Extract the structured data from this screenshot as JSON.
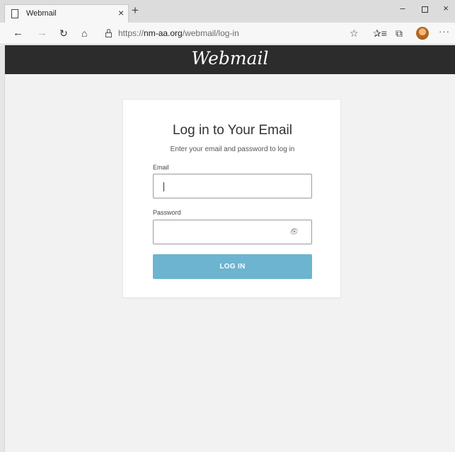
{
  "browser": {
    "tab": {
      "title": "Webmail",
      "close_symbol": "×"
    },
    "new_tab_symbol": "+",
    "window": {
      "minimize_symbol": "–",
      "close_symbol": "×"
    },
    "nav": {
      "back": "←",
      "forward": "→",
      "refresh": "↻",
      "home": "⌂"
    },
    "address": {
      "prefix": "https://",
      "host": "nm-aa.org",
      "path": "/webmail/log-in"
    },
    "toolbar": {
      "favorite": "☆",
      "favorites_list": "✰≡",
      "collections": "⧉",
      "more": "···"
    },
    "icons": [
      "page-icon",
      "lock-icon",
      "star-icon",
      "favorites-icon",
      "collections-icon",
      "profile-avatar",
      "more-icon"
    ]
  },
  "site": {
    "brand": "Webmail",
    "header_color": "#2c2c2c"
  },
  "login": {
    "title": "Log in to Your Email",
    "subtitle": "Enter your email and password to log in",
    "email_label": "Email",
    "email_value": "",
    "password_label": "Password",
    "password_value": "",
    "password_toggle_icon": "eye-slash-icon",
    "button_label": "LOG IN",
    "button_color": "#6cb4d0"
  }
}
